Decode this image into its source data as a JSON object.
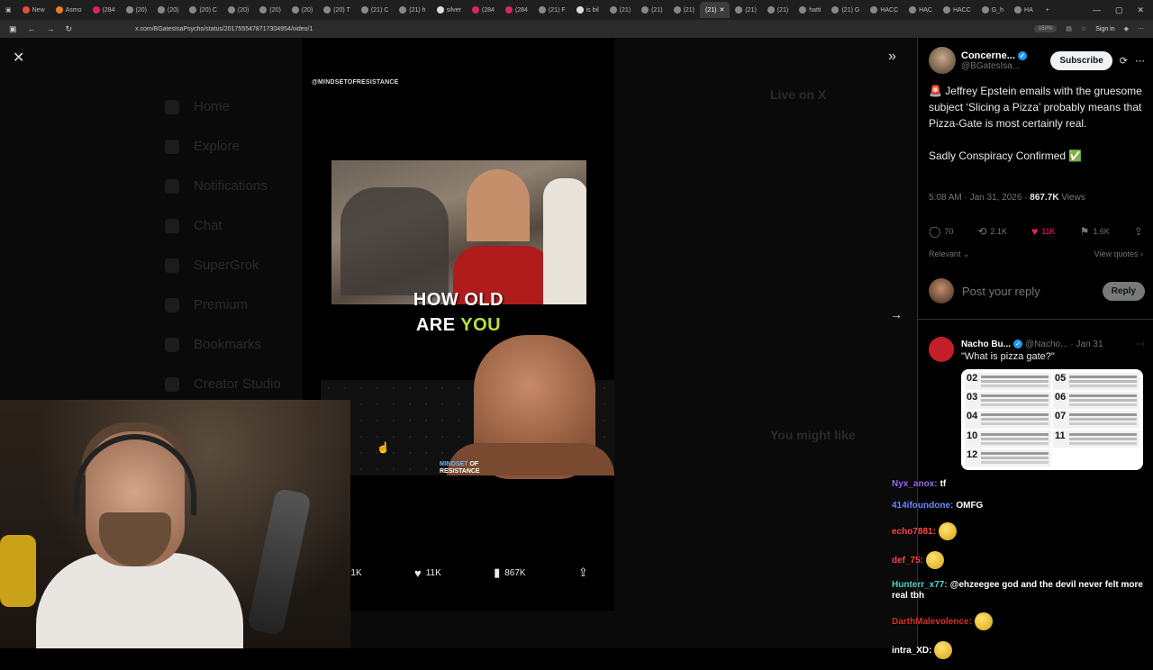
{
  "browser": {
    "tabs": [
      {
        "label": "New",
        "color": "#e74c3c"
      },
      {
        "label": "Asmo",
        "color": "#e67e22"
      },
      {
        "label": "(284",
        "color": "#e0245e"
      },
      {
        "label": "(20)",
        "color": "#888"
      },
      {
        "label": "(20)",
        "color": "#888"
      },
      {
        "label": "(20) C",
        "color": "#888"
      },
      {
        "label": "(20)",
        "color": "#888"
      },
      {
        "label": "(20)",
        "color": "#888"
      },
      {
        "label": "(20)",
        "color": "#888"
      },
      {
        "label": "(20) T",
        "color": "#888"
      },
      {
        "label": "(21) C",
        "color": "#888"
      },
      {
        "label": "(21) h",
        "color": "#888"
      },
      {
        "label": "silver",
        "color": "#ddd"
      },
      {
        "label": "(284",
        "color": "#e0245e"
      },
      {
        "label": "(284",
        "color": "#e0245e"
      },
      {
        "label": "(21) F",
        "color": "#888"
      },
      {
        "label": "is bil",
        "color": "#ddd"
      },
      {
        "label": "(21)",
        "color": "#888"
      },
      {
        "label": "(21)",
        "color": "#888"
      },
      {
        "label": "(21)",
        "color": "#888"
      },
      {
        "label": "(21)",
        "color": "#888"
      },
      {
        "label": "(21)",
        "color": "#888"
      },
      {
        "label": "hatti",
        "color": "#888"
      },
      {
        "label": "(21) G",
        "color": "#888"
      },
      {
        "label": "HACC",
        "color": "#888"
      },
      {
        "label": "HAC",
        "color": "#888"
      },
      {
        "label": "HACC",
        "color": "#888"
      },
      {
        "label": "G_h",
        "color": "#888"
      },
      {
        "label": "HA",
        "color": "#888"
      }
    ],
    "active_tab": {
      "label": "(21)"
    },
    "url": "x.com/BGatesIsaPsycho/status/2017555478717304954/video/1",
    "zoom": "150%",
    "sign_in": "Sign in"
  },
  "sidebar_ghost": [
    "Home",
    "Explore",
    "Notifications",
    "Chat",
    "SuperGrok",
    "Premium",
    "Bookmarks",
    "Creator Studio"
  ],
  "ghost_right": {
    "title": "Live on X",
    "section": "You might like"
  },
  "video": {
    "watermark_top": "@MINDSETOFRESISTANCE",
    "caption_line1": "HOW OLD",
    "caption_line2_white": "ARE ",
    "caption_line2_yellow": "YOU",
    "wm_bottom_1": "MINDSET",
    "wm_bottom_of": "OF",
    "wm_bottom_2": "RESISTANCE"
  },
  "video_actions": {
    "retweets": "2.1K",
    "likes": "11K",
    "views": "867K"
  },
  "tweet": {
    "author_name": "Concerne...",
    "author_handle": "@BGatesIsa...",
    "subscribe": "Subscribe",
    "text_line1": "Jeffrey Epstein emails with the gruesome subject ‘Slicing a Pizza’ probably means that Pizza-Gate is most certainly real.",
    "text_line2": "Sadly Conspiracy Confirmed",
    "time": "5:08 AM · Jan 31, 2026 ·",
    "views": "867.7K",
    "views_label": "Views",
    "replies": "70",
    "retweets": "2.1K",
    "likes": "11K",
    "bookmarks": "1.6K",
    "relevant": "Relevant",
    "view_quotes": "View quotes",
    "reply_placeholder": "Post your reply",
    "reply_button": "Reply"
  },
  "reply": {
    "name": "Nacho Bu...",
    "handle": "@Nacho...",
    "date": "· Jan 31",
    "text": "\"What is pizza gate?\"",
    "infographic_numbers": [
      "02",
      "05",
      "03",
      "06",
      "04",
      "07",
      "10",
      "11",
      "12"
    ]
  },
  "chat": [
    {
      "user": "Nyx_anox:",
      "color": "#9b6cf0",
      "msg": "tf"
    },
    {
      "user": "414ifoundone:",
      "color": "#6b8cff",
      "msg": "OMFG"
    },
    {
      "user": "echo7881:",
      "color": "#ff4a4a",
      "msg": ""
    },
    {
      "user": "def_75:",
      "color": "#ff4a4a",
      "msg": ""
    },
    {
      "user": "Hunterr_x77:",
      "color": "#4ad8c7",
      "msg": "@ehzeegee god and the devil never felt more real tbh"
    },
    {
      "user": "DarthMalevolence:",
      "color": "#d0342c",
      "msg": ""
    },
    {
      "user": "intra_XD:",
      "color": "#ffffff",
      "msg": ""
    }
  ]
}
